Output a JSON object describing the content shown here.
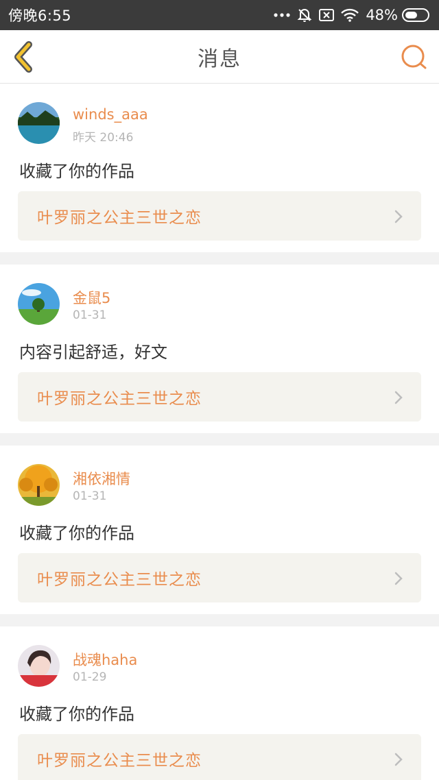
{
  "status_bar": {
    "time": "傍晚6:55",
    "battery": "48%"
  },
  "header": {
    "title": "消息"
  },
  "messages": [
    {
      "username": "winds_aaa",
      "time": "昨天 20:46",
      "content": "收藏了你的作品",
      "work": "叶罗丽之公主三世之恋"
    },
    {
      "username": "金鼠5",
      "time": "01-31",
      "content": "内容引起舒适，好文",
      "work": "叶罗丽之公主三世之恋"
    },
    {
      "username": "湘依湘情",
      "time": "01-31",
      "content": "收藏了你的作品",
      "work": "叶罗丽之公主三世之恋"
    },
    {
      "username": "战魂haha",
      "time": "01-29",
      "content": "收藏了你的作品",
      "work": "叶罗丽之公主三世之恋"
    }
  ],
  "colors": {
    "accent": "#e98c4d",
    "back_arrow": "#f2c230",
    "status_bar": "#3b3b3b",
    "work_box": "#f4f3ee"
  }
}
